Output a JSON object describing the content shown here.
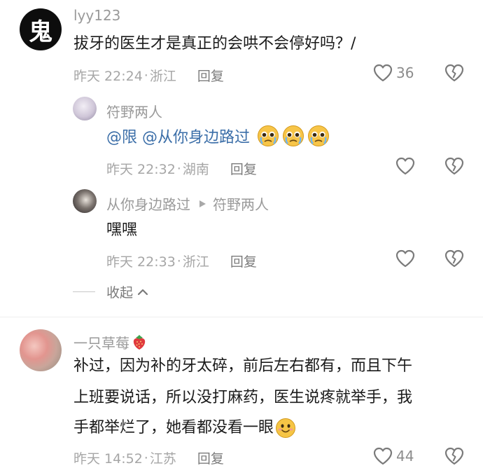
{
  "comments": [
    {
      "username": "lyy123",
      "avatar_glyph": "鬼",
      "text": "拔牙的医生才是真正的会哄不会停好吗？/",
      "time": "昨天 22:24",
      "location": "浙江",
      "reply_label": "回复",
      "like_count": "36"
    },
    {
      "username": "一只草莓",
      "text_lines": [
        "补过，因为补的牙太碎，前后左右都有，而且下午",
        "上班要说话，所以没打麻药，医生说疼就举手，我",
        "手都举烂了，她看都没看一眼"
      ],
      "time": "昨天 14:52",
      "location": "江苏",
      "reply_label": "回复",
      "like_count": "44"
    }
  ],
  "replies": [
    {
      "username": "符野两人",
      "mention_text": "@限 @从你身边路过",
      "time": "昨天 22:32",
      "location": "湖南",
      "reply_label": "回复"
    },
    {
      "username": "从你身边路过",
      "reply_to": "符野两人",
      "text": "嘿嘿",
      "time": "昨天 22:33",
      "location": "浙江",
      "reply_label": "回复"
    }
  ],
  "collapse_label": "收起",
  "separator": "·",
  "colors": {
    "meta": "#a6a6a6",
    "mention": "#3b6ea8",
    "text": "#1a1a1a"
  },
  "icons": [
    "heart-icon",
    "broken-heart-icon",
    "play-arrow-icon",
    "chevron-up-icon",
    "pleading-emoji-icon",
    "smile-emoji-icon",
    "strawberry-icon"
  ]
}
